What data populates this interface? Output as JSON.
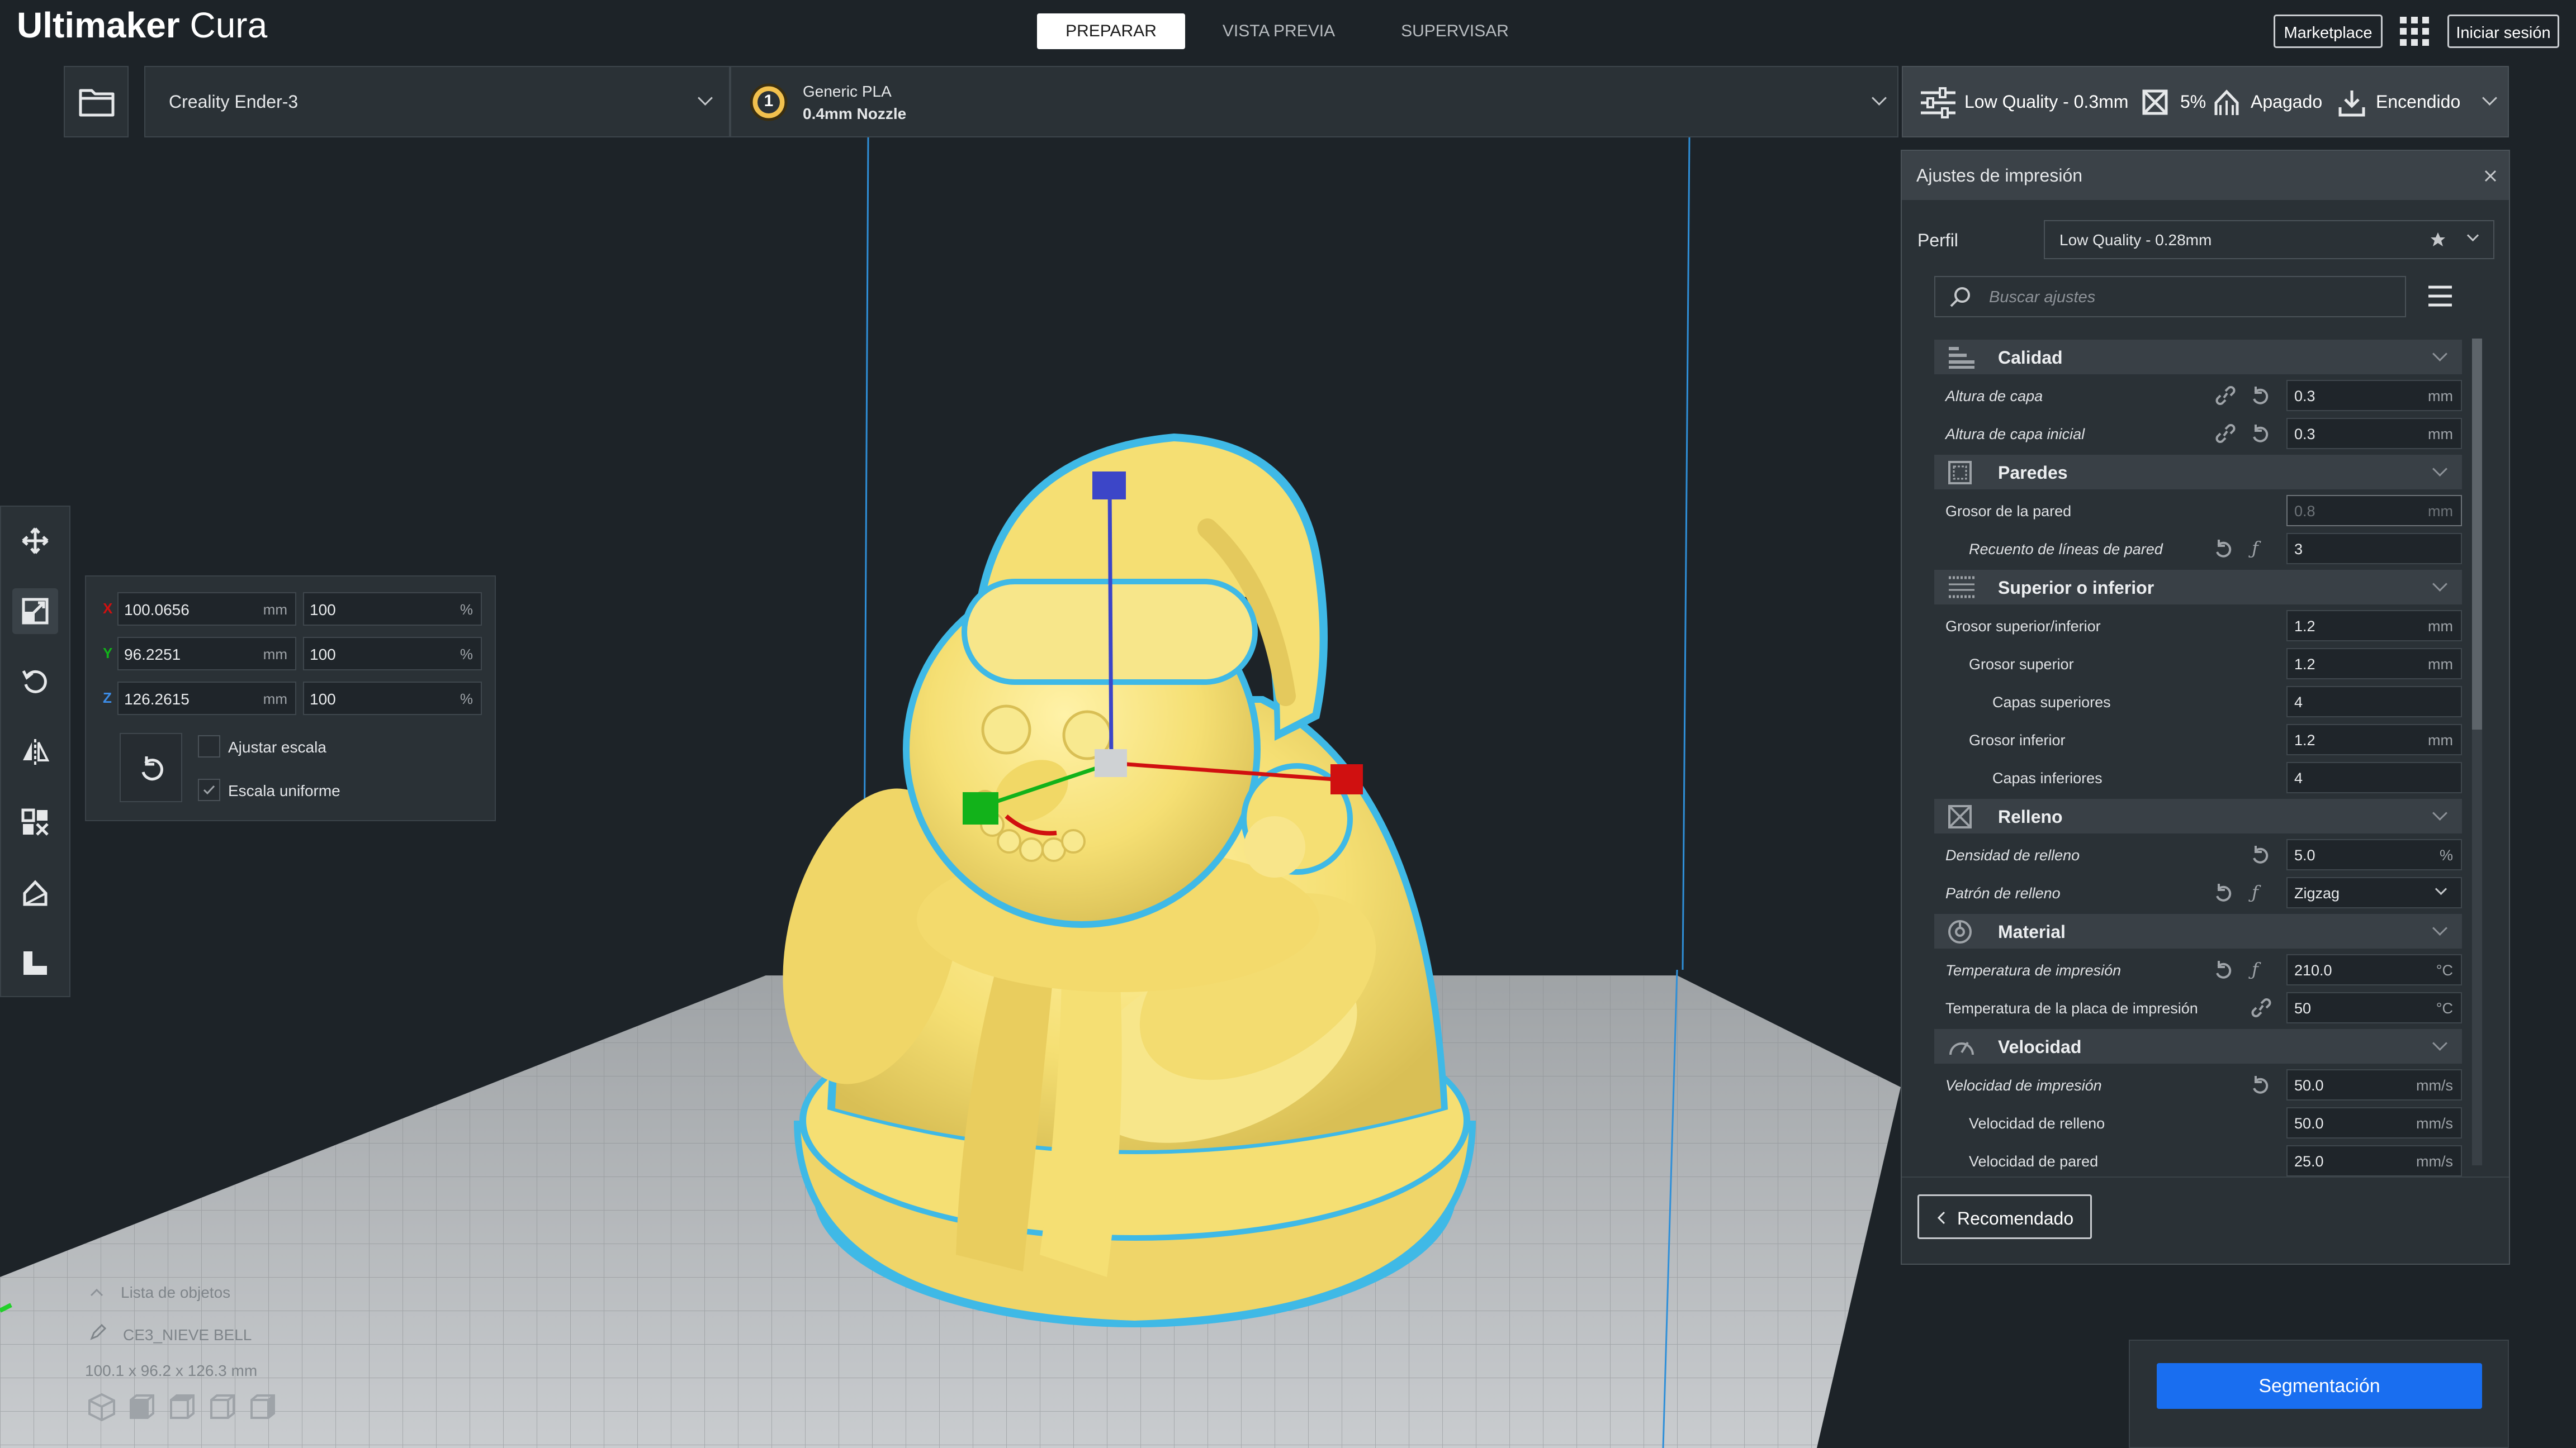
{
  "app": {
    "logo_bold": "Ultimaker",
    "logo_light": "Cura"
  },
  "stages": [
    {
      "label": "PREPARAR",
      "active": true
    },
    {
      "label": "VISTA PREVIA",
      "active": false
    },
    {
      "label": "SUPERVISAR",
      "active": false
    }
  ],
  "header_buttons": {
    "marketplace": "Marketplace",
    "signin": "Iniciar sesión"
  },
  "printer": {
    "name": "Creality Ender-3"
  },
  "material": {
    "extruder_number": "1",
    "name": "Generic PLA",
    "nozzle": "0.4mm Nozzle"
  },
  "print_settings_summary": {
    "profile": "Low Quality - 0.3mm",
    "infill": "5%",
    "support": "Apagado",
    "adhesion": "Encendido"
  },
  "settings_panel": {
    "title": "Ajustes de impresión",
    "profile_label": "Perfil",
    "profile_value": "Low Quality - 0.28mm",
    "search_placeholder": "Buscar ajustes",
    "sections": {
      "calidad": "Calidad",
      "paredes": "Paredes",
      "superior": "Superior o inferior",
      "relleno": "Relleno",
      "material": "Material",
      "velocidad": "Velocidad"
    },
    "rows": {
      "altura_capa": {
        "label": "Altura de capa",
        "value": "0.3",
        "unit": "mm"
      },
      "altura_capa_inicial": {
        "label": "Altura de capa inicial",
        "value": "0.3",
        "unit": "mm"
      },
      "grosor_pared": {
        "label": "Grosor de la pared",
        "value": "0.8",
        "unit": "mm"
      },
      "recuento_lineas": {
        "label": "Recuento de líneas de pared",
        "value": "3",
        "unit": ""
      },
      "grosor_sup_inf": {
        "label": "Grosor superior/inferior",
        "value": "1.2",
        "unit": "mm"
      },
      "grosor_superior": {
        "label": "Grosor superior",
        "value": "1.2",
        "unit": "mm"
      },
      "capas_superiores": {
        "label": "Capas superiores",
        "value": "4",
        "unit": ""
      },
      "grosor_inferior": {
        "label": "Grosor inferior",
        "value": "1.2",
        "unit": "mm"
      },
      "capas_inferiores": {
        "label": "Capas inferiores",
        "value": "4",
        "unit": ""
      },
      "densidad_relleno": {
        "label": "Densidad de relleno",
        "value": "5.0",
        "unit": "%"
      },
      "patron_relleno": {
        "label": "Patrón de relleno",
        "value": "Zigzag",
        "unit": ""
      },
      "temp_impresion": {
        "label": "Temperatura de impresión",
        "value": "210.0",
        "unit": "°C"
      },
      "temp_placa": {
        "label": "Temperatura de la placa de impresión",
        "value": "50",
        "unit": "°C"
      },
      "vel_impresion": {
        "label": "Velocidad de impresión",
        "value": "50.0",
        "unit": "mm/s"
      },
      "vel_relleno": {
        "label": "Velocidad de relleno",
        "value": "50.0",
        "unit": "mm/s"
      },
      "vel_pared": {
        "label": "Velocidad de pared",
        "value": "25.0",
        "unit": "mm/s"
      }
    },
    "recommended_button": "Recomendado"
  },
  "slice_button": "Segmentación",
  "scale_tool": {
    "x": {
      "axis": "X",
      "value": "100.0656",
      "unit": "mm",
      "percent": "100",
      "percent_unit": "%"
    },
    "y": {
      "axis": "Y",
      "value": "96.2251",
      "unit": "mm",
      "percent": "100",
      "percent_unit": "%"
    },
    "z": {
      "axis": "Z",
      "value": "126.2615",
      "unit": "mm",
      "percent": "100",
      "percent_unit": "%"
    },
    "snap_scaling": {
      "label": "Ajustar escala",
      "checked": false
    },
    "uniform_scaling": {
      "label": "Escala uniforme",
      "checked": true
    }
  },
  "object_list": {
    "title": "Lista de objetos",
    "object_name": "CE3_NIEVE BELL",
    "dimensions": "100.1 x 96.2 x 126.3 mm"
  },
  "colors": {
    "accent_blue": "#196ef0",
    "model_yellow": "#f7e27a",
    "outline_cyan": "#3fb9e6",
    "axis_x": "#d01010",
    "axis_y": "#12b21a",
    "axis_z": "#3c46c8"
  }
}
